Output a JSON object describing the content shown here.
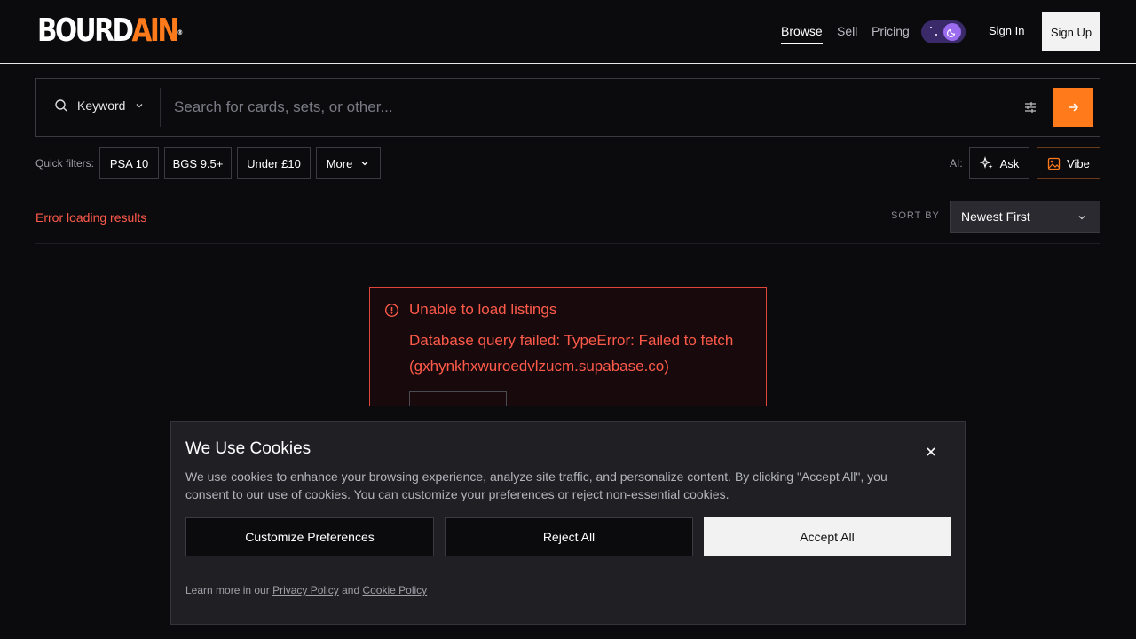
{
  "header": {
    "logo_part1": "BOURD",
    "logo_part2": "AIN",
    "logo_mark": "®",
    "nav": [
      {
        "label": "Browse",
        "active": true
      },
      {
        "label": "Sell",
        "active": false
      },
      {
        "label": "Pricing",
        "active": false
      }
    ],
    "sign_in": "Sign In",
    "sign_up": "Sign Up"
  },
  "search": {
    "mode": "Keyword",
    "placeholder": "Search for cards, sets, or other..."
  },
  "quick_filters": {
    "label": "Quick filters:",
    "chips": [
      "PSA 10",
      "BGS 9.5+",
      "Under £10",
      "More"
    ],
    "ai_label": "AI:",
    "ai_buttons": [
      "Ask",
      "Vibe"
    ]
  },
  "results": {
    "status": "Error loading results",
    "sort_label": "SORT BY",
    "sort_value": "Newest First"
  },
  "error_card": {
    "title": "Unable to load listings",
    "message": "Database query failed: TypeError: Failed to fetch (gxhynkhxwuroedvlzucm.supabase.co)"
  },
  "cookie_banner": {
    "title": "We Use Cookies",
    "body": "We use cookies to enhance your browsing experience, analyze site traffic, and personalize content. By clicking \"Accept All\", you consent to our use of cookies. You can customize your preferences or reject non-essential cookies.",
    "customize": "Customize Preferences",
    "reject": "Reject All",
    "accept": "Accept All",
    "footer_prefix": "Learn more in our",
    "privacy_link": "Privacy Policy",
    "footer_and": "and",
    "cookie_link": "Cookie Policy"
  },
  "colors": {
    "accent": "#ff7a1a",
    "error": "#ff5a4a",
    "toggle_knob": "#9b6bf0"
  }
}
